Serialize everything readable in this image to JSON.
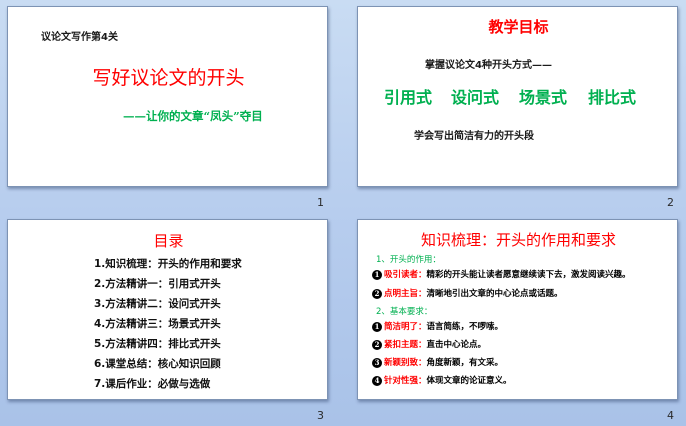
{
  "slides": [
    {
      "number": "1",
      "series": "议论文写作第4关",
      "title": "写好议论文的开头",
      "subtitle": "——让你的文章“凤头”夺目"
    },
    {
      "number": "2",
      "title": "教学目标",
      "line1": "掌握议论文4种开头方式——",
      "methods": [
        "引用式",
        "设问式",
        "场景式",
        "排比式"
      ],
      "line2": "学会写出简洁有力的开头段"
    },
    {
      "number": "3",
      "title": "目录",
      "items": [
        "1.知识梳理：开头的作用和要求",
        "2.方法精讲一：引用式开头",
        "3.方法精讲二：设问式开头",
        "4.方法精讲三：场景式开头",
        "5.方法精讲四：排比式开头",
        "6.课堂总结：核心知识回顾",
        "7.课后作业：必做与选做"
      ]
    },
    {
      "number": "4",
      "title": "知识梳理：开头的作用和要求",
      "section1": "1、开头的作用：",
      "roles": [
        {
          "n": "1",
          "label": "吸引读者：",
          "text": "精彩的开头能让读者愿意继续读下去，激发阅读兴趣。"
        },
        {
          "n": "2",
          "label": "点明主旨：",
          "text": "清晰地引出文章的中心论点或话题。"
        }
      ],
      "section2": "2、基本要求：",
      "requirements": [
        {
          "n": "1",
          "label": "简洁明了：",
          "text": "语言简练，不啰嗦。"
        },
        {
          "n": "2",
          "label": "紧扣主题：",
          "text": "直击中心论点。"
        },
        {
          "n": "3",
          "label": "新颖别致：",
          "text": "角度新颖，有文采。"
        },
        {
          "n": "4",
          "label": "针对性强：",
          "text": "体现文章的论证意义。"
        }
      ]
    }
  ]
}
